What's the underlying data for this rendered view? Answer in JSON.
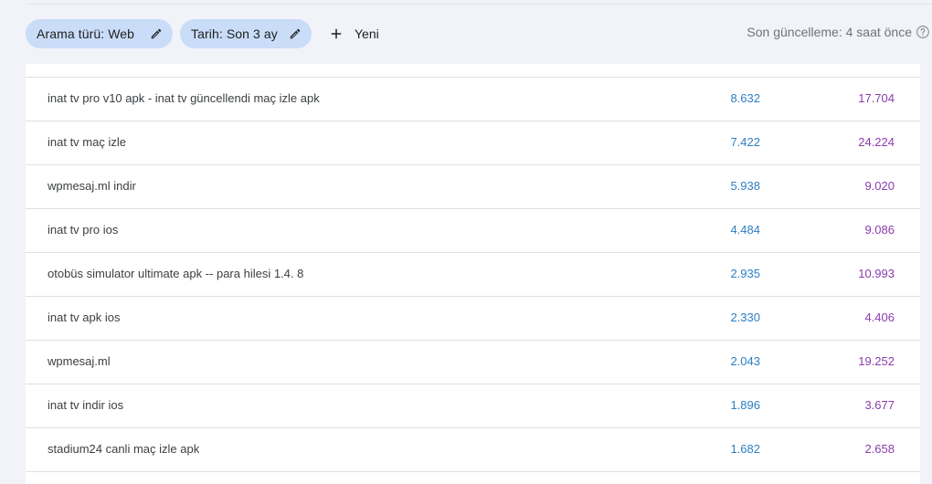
{
  "filters": {
    "search_type_chip": "Arama türü: Web",
    "date_chip": "Tarih: Son 3 ay",
    "new_button": "Yeni"
  },
  "status": {
    "last_update": "Son güncelleme: 4 saat önce"
  },
  "colors": {
    "chip_bg": "#c9dcf8",
    "clicks": "#2d7ec2",
    "impressions": "#8b3cad"
  },
  "rows": [
    {
      "query": "inat tv pro v10 apk - inat tv güncellendi maç izle apk",
      "clicks": "8.632",
      "impressions": "17.704"
    },
    {
      "query": "inat tv maç izle",
      "clicks": "7.422",
      "impressions": "24.224"
    },
    {
      "query": "wpmesaj.ml indir",
      "clicks": "5.938",
      "impressions": "9.020"
    },
    {
      "query": "inat tv pro ios",
      "clicks": "4.484",
      "impressions": "9.086"
    },
    {
      "query": "otobüs simulator ultimate apk -- para hilesi 1.4. 8",
      "clicks": "2.935",
      "impressions": "10.993"
    },
    {
      "query": "inat tv apk ios",
      "clicks": "2.330",
      "impressions": "4.406"
    },
    {
      "query": "wpmesaj.ml",
      "clicks": "2.043",
      "impressions": "19.252"
    },
    {
      "query": "inat tv indir ios",
      "clicks": "1.896",
      "impressions": "3.677"
    },
    {
      "query": "stadium24 canli maç izle apk",
      "clicks": "1.682",
      "impressions": "2.658"
    }
  ]
}
